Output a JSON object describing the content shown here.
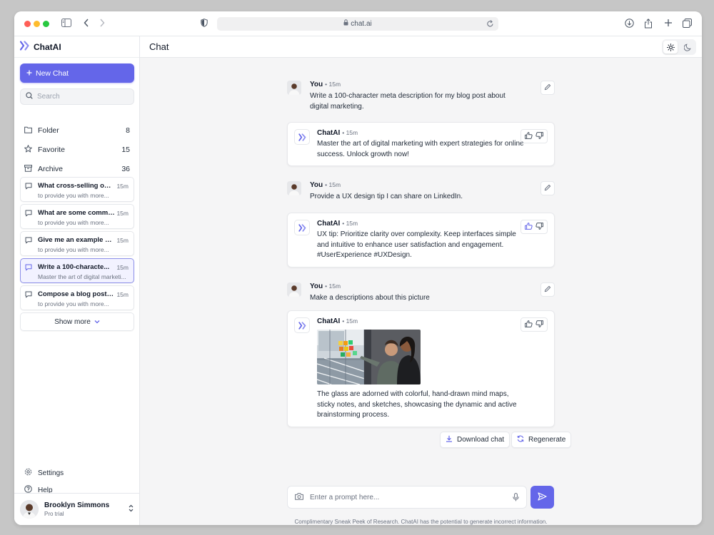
{
  "browser": {
    "url": "chat.ai"
  },
  "brand": {
    "name": "ChatAI",
    "color": "#6466e9"
  },
  "sidebar": {
    "new_chat": "New Chat",
    "search_placeholder": "Search",
    "nav": [
      {
        "label": "Folder",
        "count": "8",
        "icon": "folder-icon"
      },
      {
        "label": "Favorite",
        "count": "15",
        "icon": "star-icon"
      },
      {
        "label": "Archive",
        "count": "36",
        "icon": "archive-icon"
      }
    ],
    "chats": [
      {
        "title": "What cross-selling oppo...",
        "time": "15m",
        "preview": "to provide you with more...",
        "active": false
      },
      {
        "title": "What are some common...",
        "time": "15m",
        "preview": "to provide you with more...",
        "active": false
      },
      {
        "title": "Give me an example of...",
        "time": "15m",
        "preview": "to provide you with more...",
        "active": false
      },
      {
        "title": "Write a 100-characte...",
        "time": "15m",
        "preview": "Master the art of digital marketi...",
        "active": true
      },
      {
        "title": "Compose a blog post of...",
        "time": "15m",
        "preview": "to provide you with more...",
        "active": false
      }
    ],
    "show_more": "Show more",
    "settings": "Settings",
    "help": "Help",
    "user": {
      "name": "Brooklyn Simmons",
      "plan": "Pro trial"
    }
  },
  "main": {
    "title": "Chat",
    "messages": [
      {
        "role": "user",
        "name": "You",
        "time": "15m",
        "text": "Write a 100-character meta description for my blog post about digital marketing."
      },
      {
        "role": "bot",
        "name": "ChatAI",
        "time": "15m",
        "text": "Master the art of digital marketing with expert strategies for online success. Unlock growth now!",
        "liked": false
      },
      {
        "role": "user",
        "name": "You",
        "time": "15m",
        "text": "Provide a UX design tip I can share on LinkedIn."
      },
      {
        "role": "bot",
        "name": "ChatAI",
        "time": "15m",
        "text": "UX tip: Prioritize clarity over complexity. Keep interfaces simple and intuitive to enhance user satisfaction and engagement. #UserExperience #UXDesign.",
        "liked": true
      },
      {
        "role": "user",
        "name": "You",
        "time": "15m",
        "text": "Make a descriptions about this picture"
      },
      {
        "role": "bot",
        "name": "ChatAI",
        "time": "15m",
        "text": "The glass are adorned with colorful, hand-drawn mind maps, sticky notes, and sketches, showcasing the dynamic and active brainstorming process.",
        "liked": false
      }
    ],
    "download_chat": "Download chat",
    "regenerate": "Regenerate",
    "prompt_placeholder": "Enter a prompt here...",
    "disclaimer": "Complimentary Sneak Peek of Research. ChatAI has the potential to generate incorrect information."
  }
}
